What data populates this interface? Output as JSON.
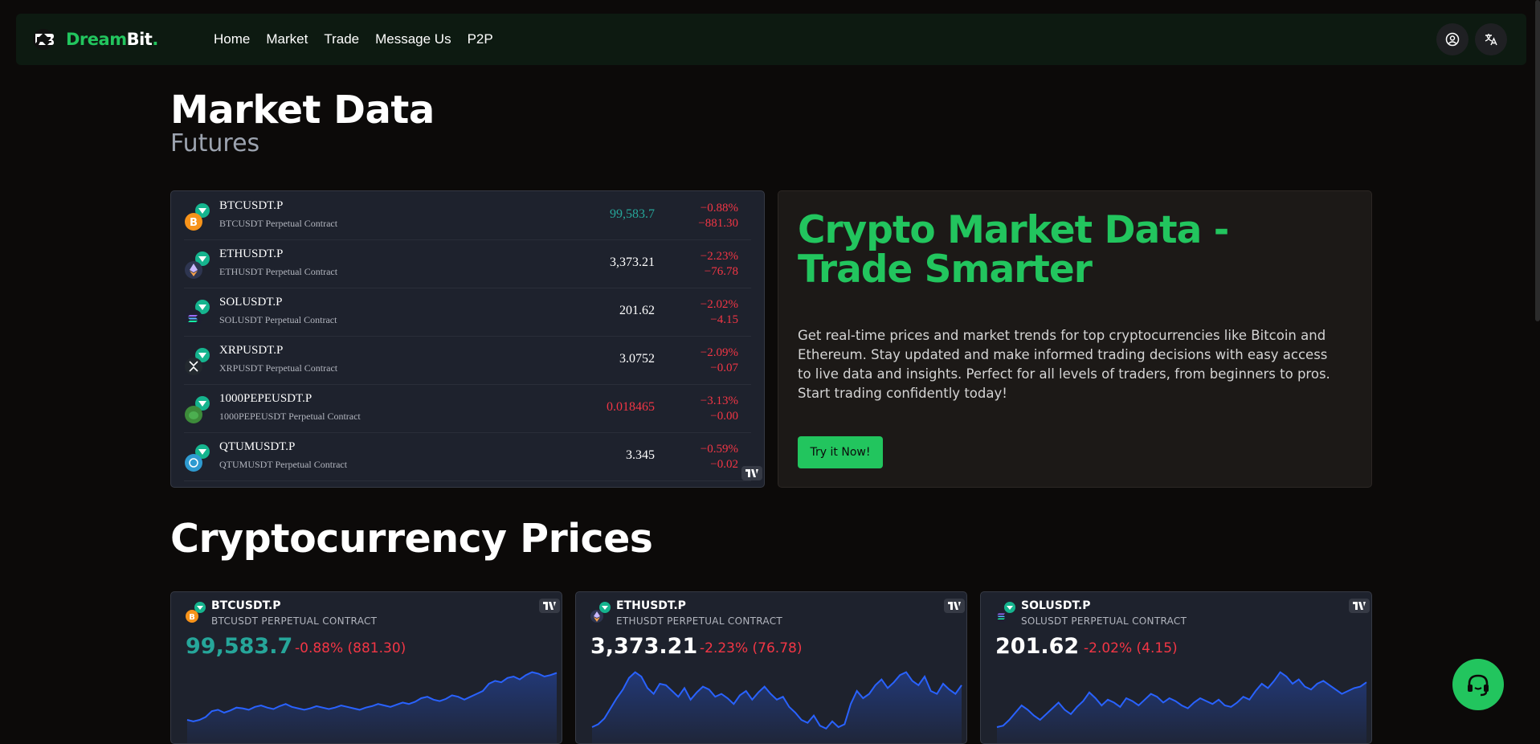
{
  "brand": {
    "name_part1": "Dream",
    "name_part2": "Bit",
    "name_dot": "."
  },
  "nav": {
    "links": [
      "Home",
      "Market",
      "Trade",
      "Message Us",
      "P2P"
    ]
  },
  "header": {
    "title": "Market Data",
    "subtitle": "Futures"
  },
  "futures": {
    "rows": [
      {
        "symbol": "BTCUSDT.P",
        "desc": "BTCUSDT Perpetual Contract",
        "price": "99,583.7",
        "pct": "−0.88%",
        "chg": "−881.30",
        "coin_icon": "bitcoin-icon",
        "coin_color": "#f7931a",
        "price_color": "#26a69a"
      },
      {
        "symbol": "ETHUSDT.P",
        "desc": "ETHUSDT Perpetual Contract",
        "price": "3,373.21",
        "pct": "−2.23%",
        "chg": "−76.78",
        "coin_icon": "ethereum-icon",
        "coin_color": "#2e3550",
        "price_color": "#ffffff"
      },
      {
        "symbol": "SOLUSDT.P",
        "desc": "SOLUSDT Perpetual Contract",
        "price": "201.62",
        "pct": "−2.02%",
        "chg": "−4.15",
        "coin_icon": "solana-icon",
        "coin_color": "#1e2030",
        "price_color": "#ffffff"
      },
      {
        "symbol": "XRPUSDT.P",
        "desc": "XRPUSDT Perpetual Contract",
        "price": "3.0752",
        "pct": "−2.09%",
        "chg": "−0.07",
        "coin_icon": "xrp-icon",
        "coin_color": "#23292f",
        "price_color": "#ffffff"
      },
      {
        "symbol": "1000PEPEUSDT.P",
        "desc": "1000PEPEUSDT Perpetual Contract",
        "price": "0.018465",
        "pct": "−3.13%",
        "chg": "−0.00",
        "coin_icon": "pepe-icon",
        "coin_color": "#3d8b3a",
        "price_color": "#f23645"
      },
      {
        "symbol": "QTUMUSDT.P",
        "desc": "QTUMUSDT Perpetual Contract",
        "price": "3.345",
        "pct": "−0.59%",
        "chg": "−0.02",
        "coin_icon": "qtum-icon",
        "coin_color": "#2e9ad0",
        "price_color": "#ffffff"
      }
    ]
  },
  "hero": {
    "title": "Crypto Market Data - Trade Smarter",
    "text": "Get real-time prices and market trends for top cryptocurrencies like Bitcoin and Ethereum. Stay updated and make informed trading decisions with easy access to live data and insights. Perfect for all levels of traders, from beginners to pros. Start trading confidently today!",
    "cta": "Try it Now!"
  },
  "prices_section": {
    "title": "Cryptocurrency Prices"
  },
  "price_cards": [
    {
      "symbol": "BTCUSDT.P",
      "desc": "BTCUSDT PERPETUAL CONTRACT",
      "price": "99,583.7",
      "change": "-0.88% (881.30)",
      "price_color": "#26a69a",
      "coin_icon": "bitcoin-icon",
      "coin_color": "#f7931a",
      "series": [
        30,
        28,
        30,
        34,
        42,
        44,
        40,
        43,
        47,
        46,
        44,
        48,
        50,
        47,
        45,
        49,
        52,
        48,
        46,
        44,
        46,
        49,
        47,
        45,
        47,
        50,
        48,
        46,
        44,
        47,
        49,
        52,
        50,
        48,
        51,
        54,
        52,
        55,
        60,
        62,
        58,
        56,
        59,
        64,
        62,
        58,
        62,
        66,
        70,
        80,
        84,
        82,
        88,
        90,
        86,
        92,
        96,
        94,
        90,
        92,
        95
      ]
    },
    {
      "symbol": "ETHUSDT.P",
      "desc": "ETHUSDT PERPETUAL CONTRACT",
      "price": "3,373.21",
      "change": "-2.23% (76.78)",
      "price_color": "#ffffff",
      "coin_icon": "ethereum-icon",
      "coin_color": "#2e3550",
      "series": [
        20,
        24,
        32,
        46,
        60,
        72,
        88,
        96,
        90,
        74,
        66,
        80,
        78,
        70,
        62,
        74,
        58,
        68,
        76,
        72,
        62,
        66,
        60,
        52,
        64,
        70,
        58,
        68,
        76,
        66,
        58,
        62,
        48,
        40,
        30,
        26,
        36,
        22,
        18,
        28,
        20,
        24,
        52,
        70,
        60,
        66,
        78,
        86,
        74,
        82,
        92,
        96,
        84,
        78,
        90,
        70,
        66,
        80,
        72,
        66,
        78
      ]
    },
    {
      "symbol": "SOLUSDT.P",
      "desc": "SOLUSDT PERPETUAL CONTRACT",
      "price": "201.62",
      "change": "-2.02% (4.15)",
      "price_color": "#ffffff",
      "coin_icon": "solana-icon",
      "coin_color": "#1e2030",
      "series": [
        20,
        22,
        30,
        40,
        50,
        44,
        36,
        30,
        38,
        46,
        54,
        44,
        38,
        48,
        56,
        68,
        60,
        50,
        58,
        54,
        48,
        60,
        56,
        50,
        58,
        66,
        62,
        54,
        60,
        56,
        50,
        46,
        54,
        60,
        56,
        52,
        58,
        50,
        48,
        54,
        62,
        58,
        70,
        80,
        74,
        84,
        96,
        90,
        80,
        86,
        76,
        72,
        80,
        84,
        78,
        72,
        66,
        70,
        74,
        76,
        82
      ]
    }
  ],
  "colors": {
    "accent": "#22c55e",
    "negative": "#f23645",
    "positive": "#26a69a",
    "line": "#2962ff"
  }
}
